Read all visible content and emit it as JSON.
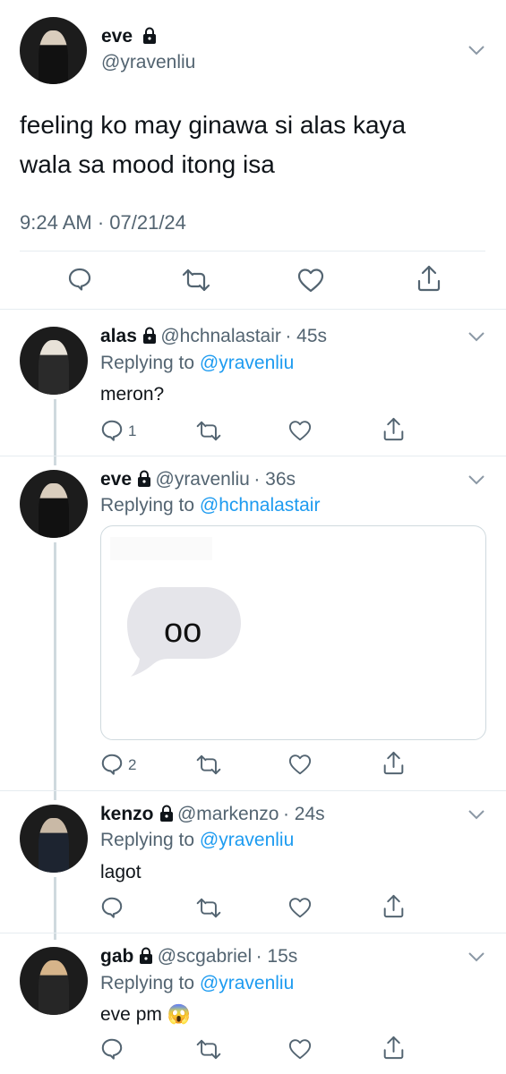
{
  "main_tweet": {
    "name": "eve",
    "handle": "@yravenliu",
    "text_line1": "feeling ko may ginawa si alas kaya",
    "text_line2": "wala sa mood itong isa",
    "timestamp": "9:24 AM · 07/21/24"
  },
  "replies": [
    {
      "name": "alas",
      "handle": "@hchnalastair",
      "time": "· 45s",
      "replying_label": "Replying to",
      "replying_to": "@yravenliu",
      "text": "meron?",
      "reply_count": "1"
    },
    {
      "name": "eve",
      "handle": "@yravenliu",
      "time": "· 36s",
      "replying_label": "Replying to",
      "replying_to": "@hchnalastair",
      "media_bubble_text": "oo",
      "reply_count": "2"
    },
    {
      "name": "kenzo",
      "handle": "@markenzo",
      "time": "· 24s",
      "replying_label": "Replying to",
      "replying_to": "@yravenliu",
      "text": "lagot"
    },
    {
      "name": "gab",
      "handle": "@scgabriel",
      "time": "· 15s",
      "replying_label": "Replying to",
      "replying_to": "@yravenliu",
      "text": "eve pm",
      "emoji": "😱"
    }
  ],
  "colors": {
    "link": "#1d9bf0",
    "secondary": "#536471",
    "divider": "#e6ecf0"
  }
}
